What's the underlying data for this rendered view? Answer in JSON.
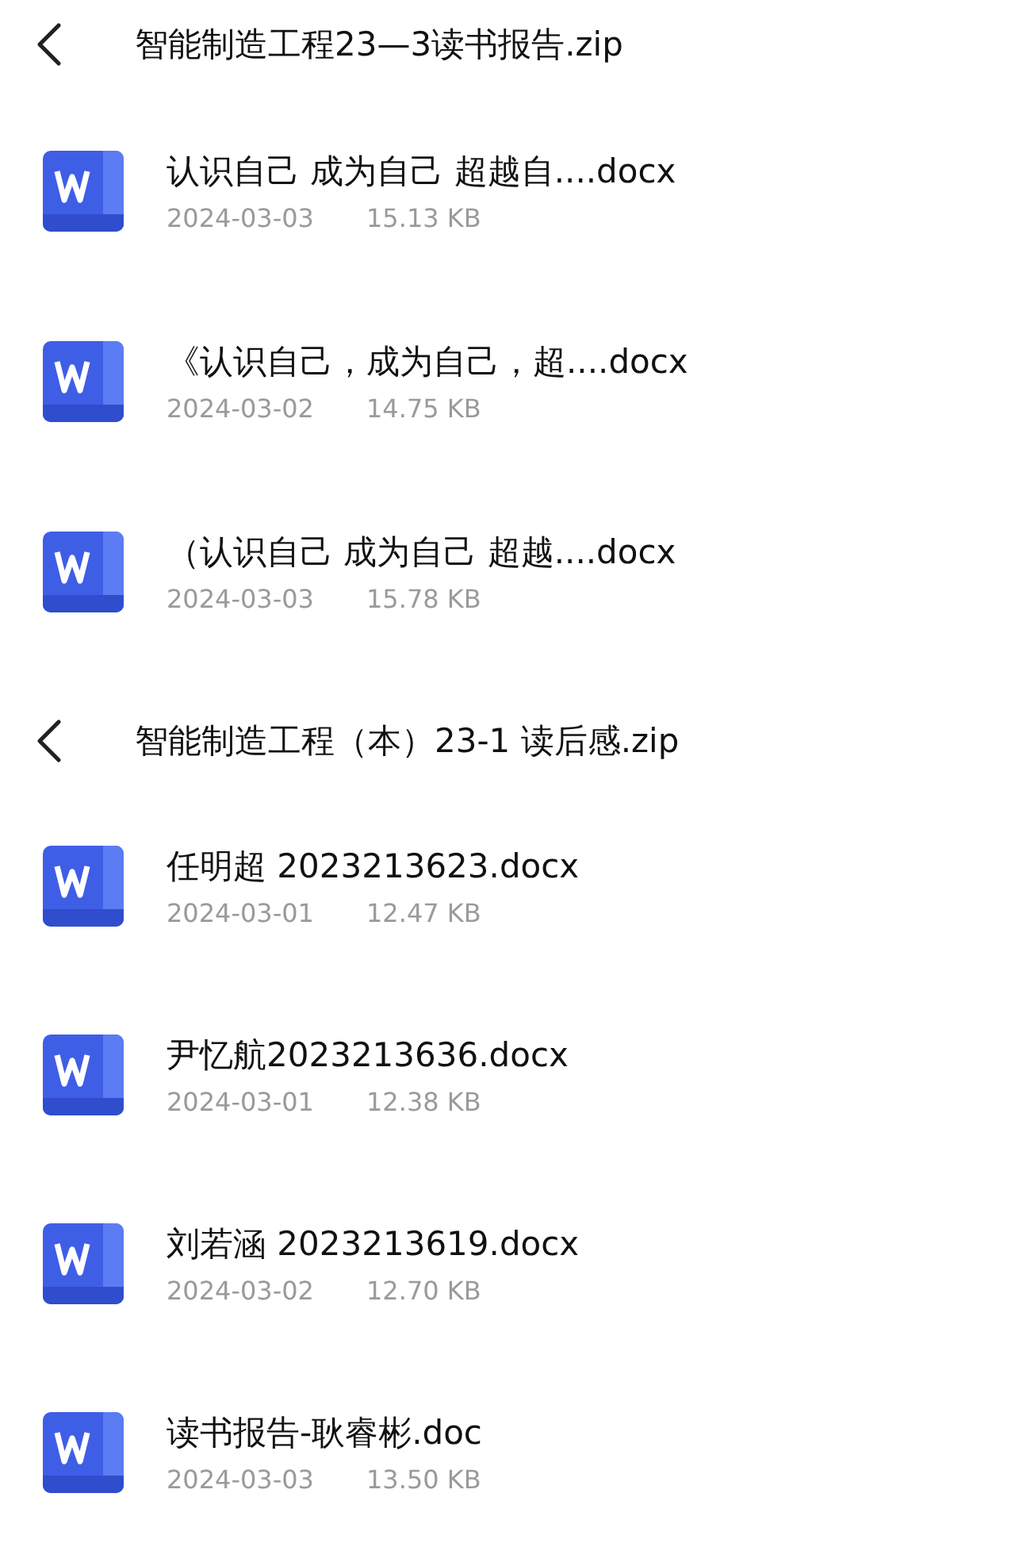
{
  "sections": [
    {
      "title": "智能制造工程23—3读书报告.zip",
      "files": [
        {
          "name": "认识自己 成为自己 超越自....docx",
          "date": "2024-03-03",
          "size": "15.13 KB"
        },
        {
          "name": "《认识自己，成为自己，超....docx",
          "date": "2024-03-02",
          "size": "14.75 KB"
        },
        {
          "name": "（认识自己 成为自己 超越....docx",
          "date": "2024-03-03",
          "size": "15.78 KB"
        }
      ]
    },
    {
      "title": "智能制造工程（本）23-1 读后感.zip",
      "files": [
        {
          "name": "任明超 2023213623.docx",
          "date": "2024-03-01",
          "size": "12.47 KB"
        },
        {
          "name": "尹忆航2023213636.docx",
          "date": "2024-03-01",
          "size": "12.38 KB"
        },
        {
          "name": "刘若涵 2023213619.docx",
          "date": "2024-03-02",
          "size": "12.70 KB"
        },
        {
          "name": "读书报告-耿睿彬.doc",
          "date": "2024-03-03",
          "size": "13.50 KB"
        }
      ]
    }
  ]
}
